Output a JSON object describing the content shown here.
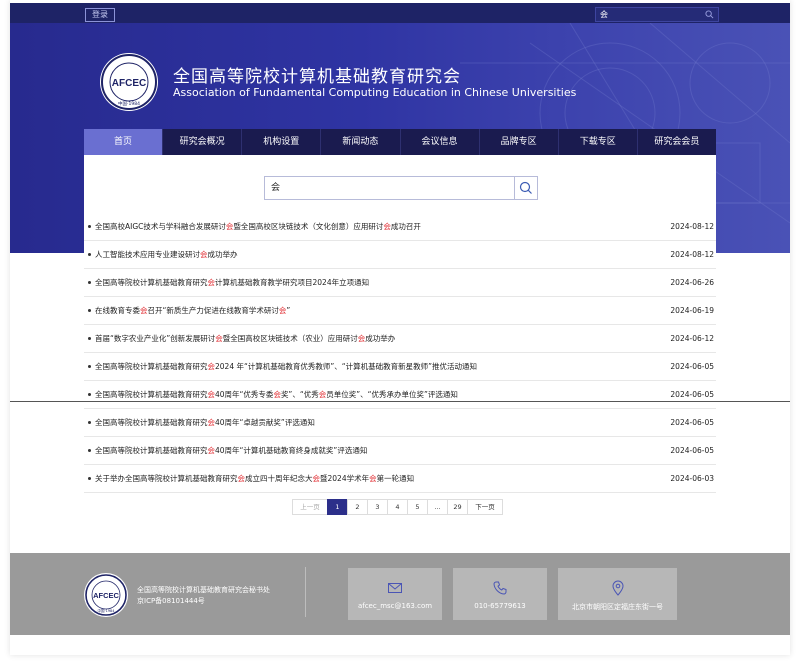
{
  "header": {
    "login_label": "登录",
    "search_value": "会"
  },
  "site": {
    "title_cn": "全国高等院校计算机基础教育研究会",
    "title_en": "Association of Fundamental Computing Education in Chinese Universities",
    "logo_text": "AFCEC",
    "logo_year": "中国·1984"
  },
  "nav": [
    "首页",
    "研究会概况",
    "机构设置",
    "新闻动态",
    "会议信息",
    "品牌专区",
    "下载专区",
    "研究会会员"
  ],
  "search": {
    "query": "会"
  },
  "results": [
    {
      "title": "全国高校AIGC技术与学科融合发展研讨会暨全国高校区块链技术（文化创意）应用研讨会成功召开",
      "date": "2024-08-12"
    },
    {
      "title": "人工智能技术应用专业建设研讨会成功举办",
      "date": "2024-08-12"
    },
    {
      "title": "全国高等院校计算机基础教育研究会计算机基础教育教学研究项目2024年立项通知",
      "date": "2024-06-26"
    },
    {
      "title": "在线教育专委会召开“新质生产力促进在线教育学术研讨会”",
      "date": "2024-06-19"
    },
    {
      "title": "首届“数字农业产业化”创新发展研讨会暨全国高校区块链技术（农业）应用研讨会成功举办",
      "date": "2024-06-12"
    },
    {
      "title": "全国高等院校计算机基础教育研究会2024 年“计算机基础教育优秀教师”、“计算机基础教育新星教师”推优活动通知",
      "date": "2024-06-05"
    },
    {
      "title": "全国高等院校计算机基础教育研究会40周年“优秀专委会奖”、“优秀会员单位奖”、“优秀承办单位奖”评选通知",
      "date": "2024-06-05"
    },
    {
      "title": "全国高等院校计算机基础教育研究会40周年“卓越贡献奖”评选通知",
      "date": "2024-06-05"
    },
    {
      "title": "全国高等院校计算机基础教育研究会40周年“计算机基础教育终身成就奖”评选通知",
      "date": "2024-06-05"
    },
    {
      "title": "关于举办全国高等院校计算机基础教育研究会成立四十周年纪念大会暨2024学术年会第一轮通知",
      "date": "2024-06-03"
    }
  ],
  "pagination": {
    "prev": "上一页",
    "pages": [
      "1",
      "2",
      "3",
      "4",
      "5",
      "...",
      "29"
    ],
    "current": "1",
    "next": "下一页"
  },
  "footer": {
    "org": "全国高等院校计算机基础教育研究会秘书处",
    "icp": "京ICP备08101444号",
    "email": "afcec_msc@163.com",
    "phone": "010-65779613",
    "address": "北京市朝阳区定福庄东街一号"
  },
  "colors": {
    "brand_dark": "#1e2366",
    "nav_active": "#6a6fd1",
    "highlight": "#e0262b",
    "footer_bg": "#9a9a9a"
  },
  "icons": [
    "search-icon",
    "mail-icon",
    "phone-icon",
    "location-icon"
  ]
}
